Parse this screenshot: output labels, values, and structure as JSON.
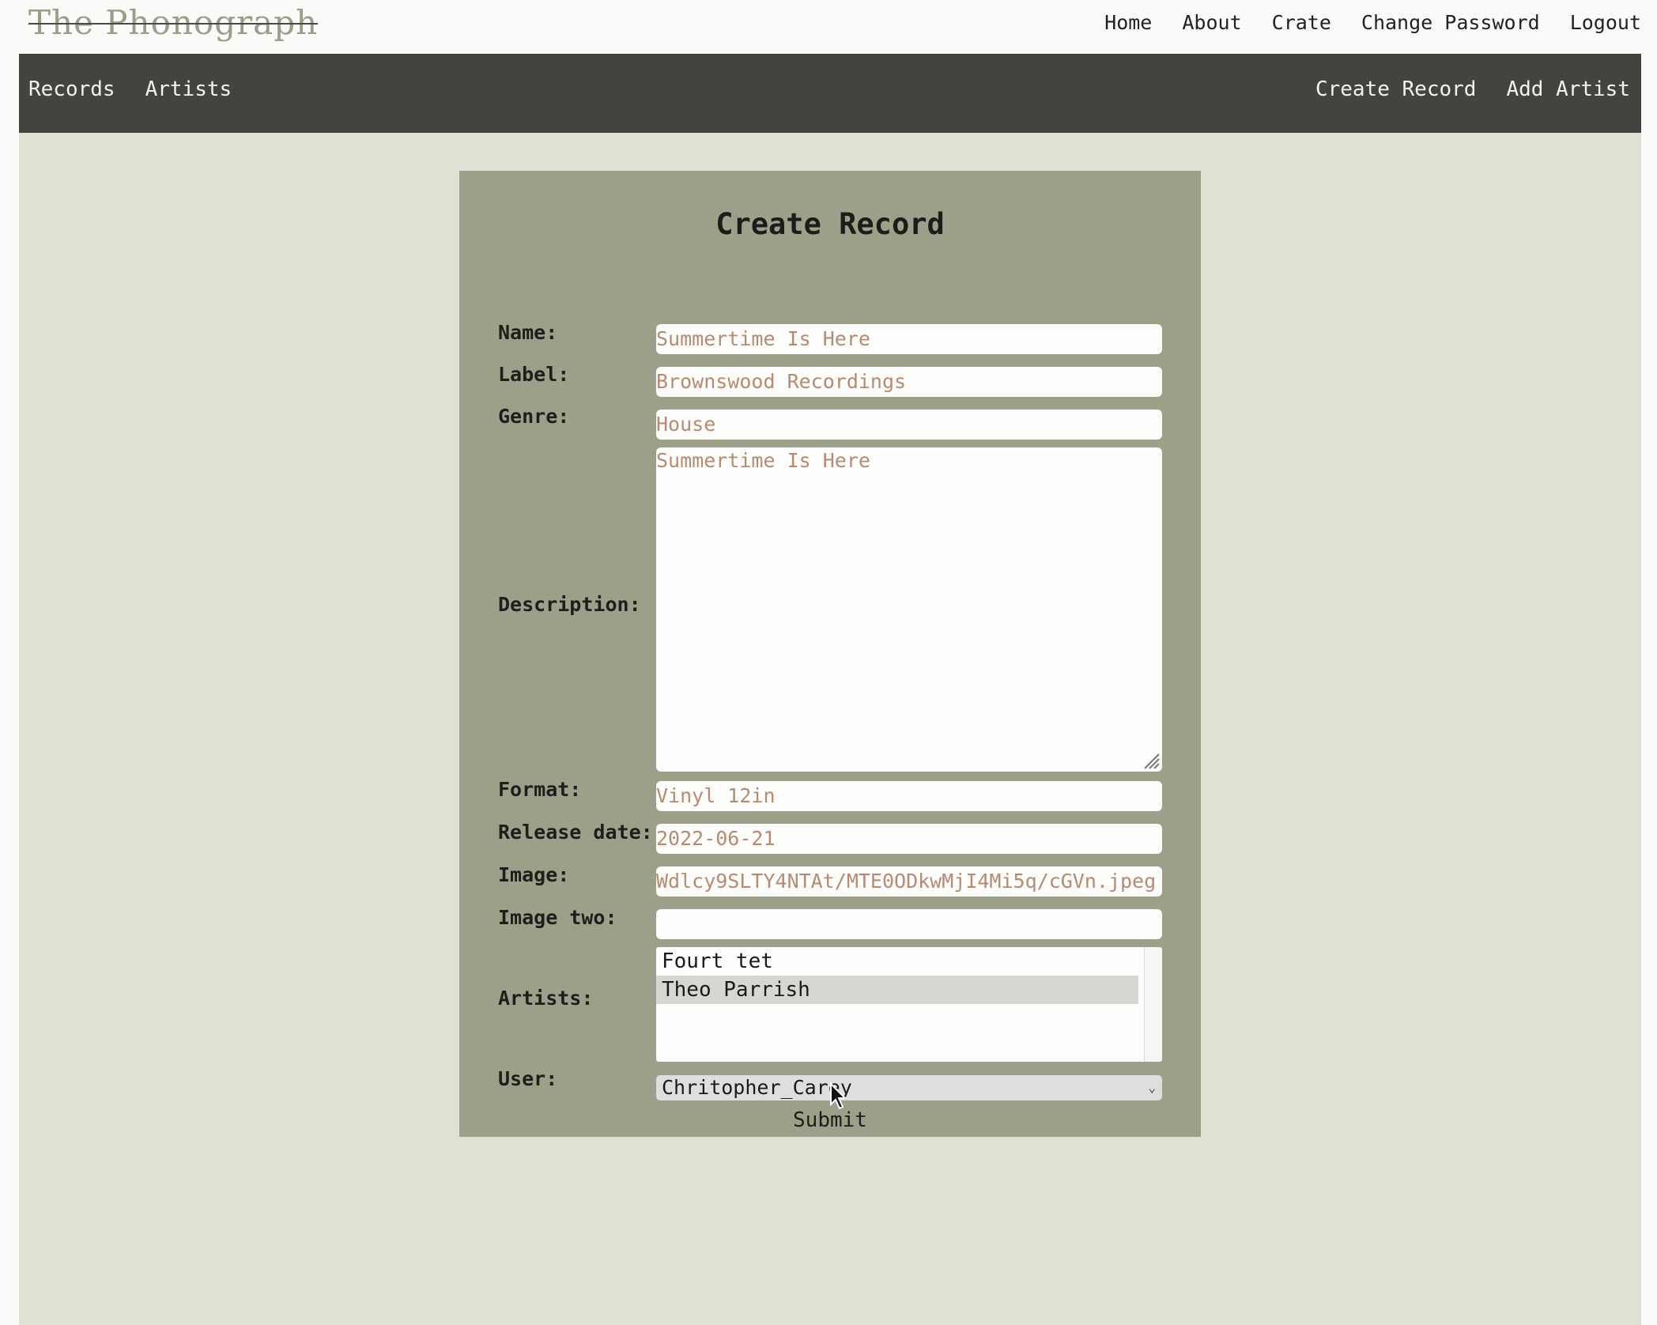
{
  "header": {
    "logo": "The Phonograph",
    "links": [
      "Home",
      "About",
      "Crate",
      "Change Password",
      "Logout"
    ]
  },
  "navbar": {
    "left": [
      "Records",
      "Artists"
    ],
    "right": [
      "Create Record",
      "Add Artist"
    ]
  },
  "form": {
    "title": "Create Record",
    "labels": {
      "name": "Name:",
      "label": "Label:",
      "genre": "Genre:",
      "description": "Description:",
      "format": "Format:",
      "release_date": "Release date:",
      "image": "Image:",
      "image_two": "Image two:",
      "artists": "Artists:",
      "user": "User:"
    },
    "values": {
      "name": "Summertime Is Here",
      "label": "Brownswood Recordings",
      "genre": "House",
      "description": "Summertime Is Here",
      "format": "Vinyl 12in",
      "release_date": "2022-06-21",
      "image": "Wdlcy9SLTY4NTAt/MTE0ODkwMjI4Mi5q/cGVn.jpeg",
      "image_two": ""
    },
    "artists_options": [
      "Fourt tet",
      "Theo Parrish"
    ],
    "artists_selected": "Theo Parrish",
    "user_selected": "Chritopher_Carey",
    "submit_label": "Submit"
  },
  "colors": {
    "navbar_bg": "#44433f",
    "content_bg": "#e1e0d5",
    "form_bg": "#9da089",
    "input_text": "#b78a72",
    "logo_text": "#9a9e88"
  }
}
